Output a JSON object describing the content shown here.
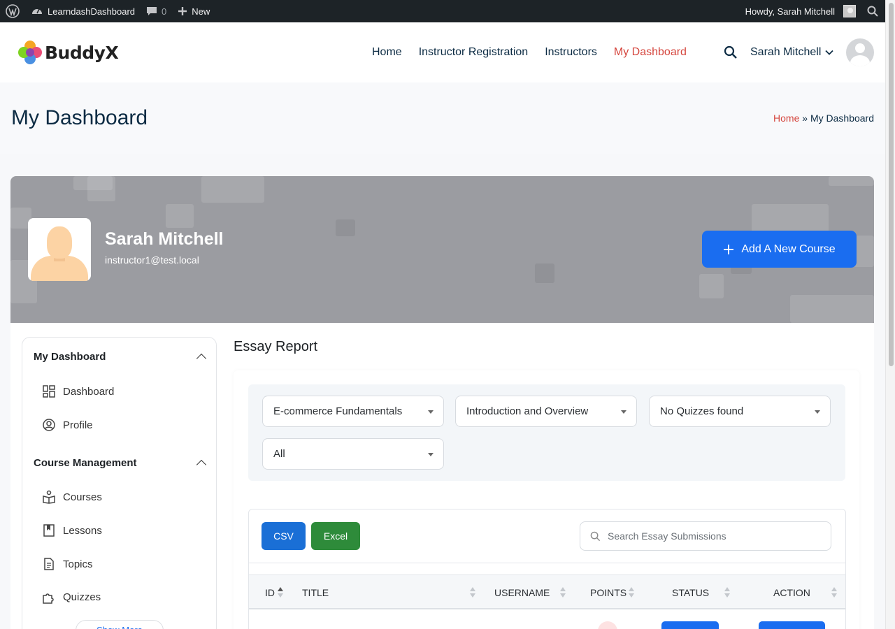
{
  "adminbar": {
    "site_name": "LearndashDashboard",
    "comments_count": "0",
    "new_label": "New",
    "howdy": "Howdy, Sarah Mitchell"
  },
  "header": {
    "logo_text": "BuddyX",
    "nav": [
      {
        "label": "Home",
        "active": false
      },
      {
        "label": "Instructor Registration",
        "active": false
      },
      {
        "label": "Instructors",
        "active": false
      },
      {
        "label": "My Dashboard",
        "active": true
      }
    ],
    "user_name": "Sarah Mitchell"
  },
  "page": {
    "title": "My Dashboard",
    "breadcrumb": {
      "home": "Home",
      "separator": "»",
      "current": "My Dashboard"
    }
  },
  "profile": {
    "name": "Sarah Mitchell",
    "email": "instructor1@test.local",
    "add_course_label": "Add A New Course"
  },
  "sidebar": {
    "sections": [
      {
        "title": "My Dashboard",
        "items": [
          {
            "label": "Dashboard",
            "icon": "dashboard-grid-icon"
          },
          {
            "label": "Profile",
            "icon": "user-circle-icon"
          }
        ]
      },
      {
        "title": "Course Management",
        "items": [
          {
            "label": "Courses",
            "icon": "book-open-icon"
          },
          {
            "label": "Lessons",
            "icon": "bookmark-book-icon"
          },
          {
            "label": "Topics",
            "icon": "document-icon"
          },
          {
            "label": "Quizzes",
            "icon": "puzzle-icon"
          }
        ]
      }
    ],
    "show_more_label": "Show More"
  },
  "report": {
    "title": "Essay Report",
    "filters": {
      "course": "E-commerce Fundamentals",
      "lesson": "Introduction and Overview",
      "quiz": "No Quizzes found",
      "status": "All"
    },
    "buttons": {
      "csv": "CSV",
      "excel": "Excel"
    },
    "search_placeholder": "Search Essay Submissions",
    "columns": [
      "ID",
      "TITLE",
      "USERNAME",
      "POINTS",
      "STATUS",
      "ACTION"
    ]
  },
  "colors": {
    "accent": "#1a6df0",
    "nav_active": "#d5463e",
    "excel_green": "#2e8b3a",
    "admin_bar": "#1d2327",
    "title_navy": "#0d2c44"
  }
}
